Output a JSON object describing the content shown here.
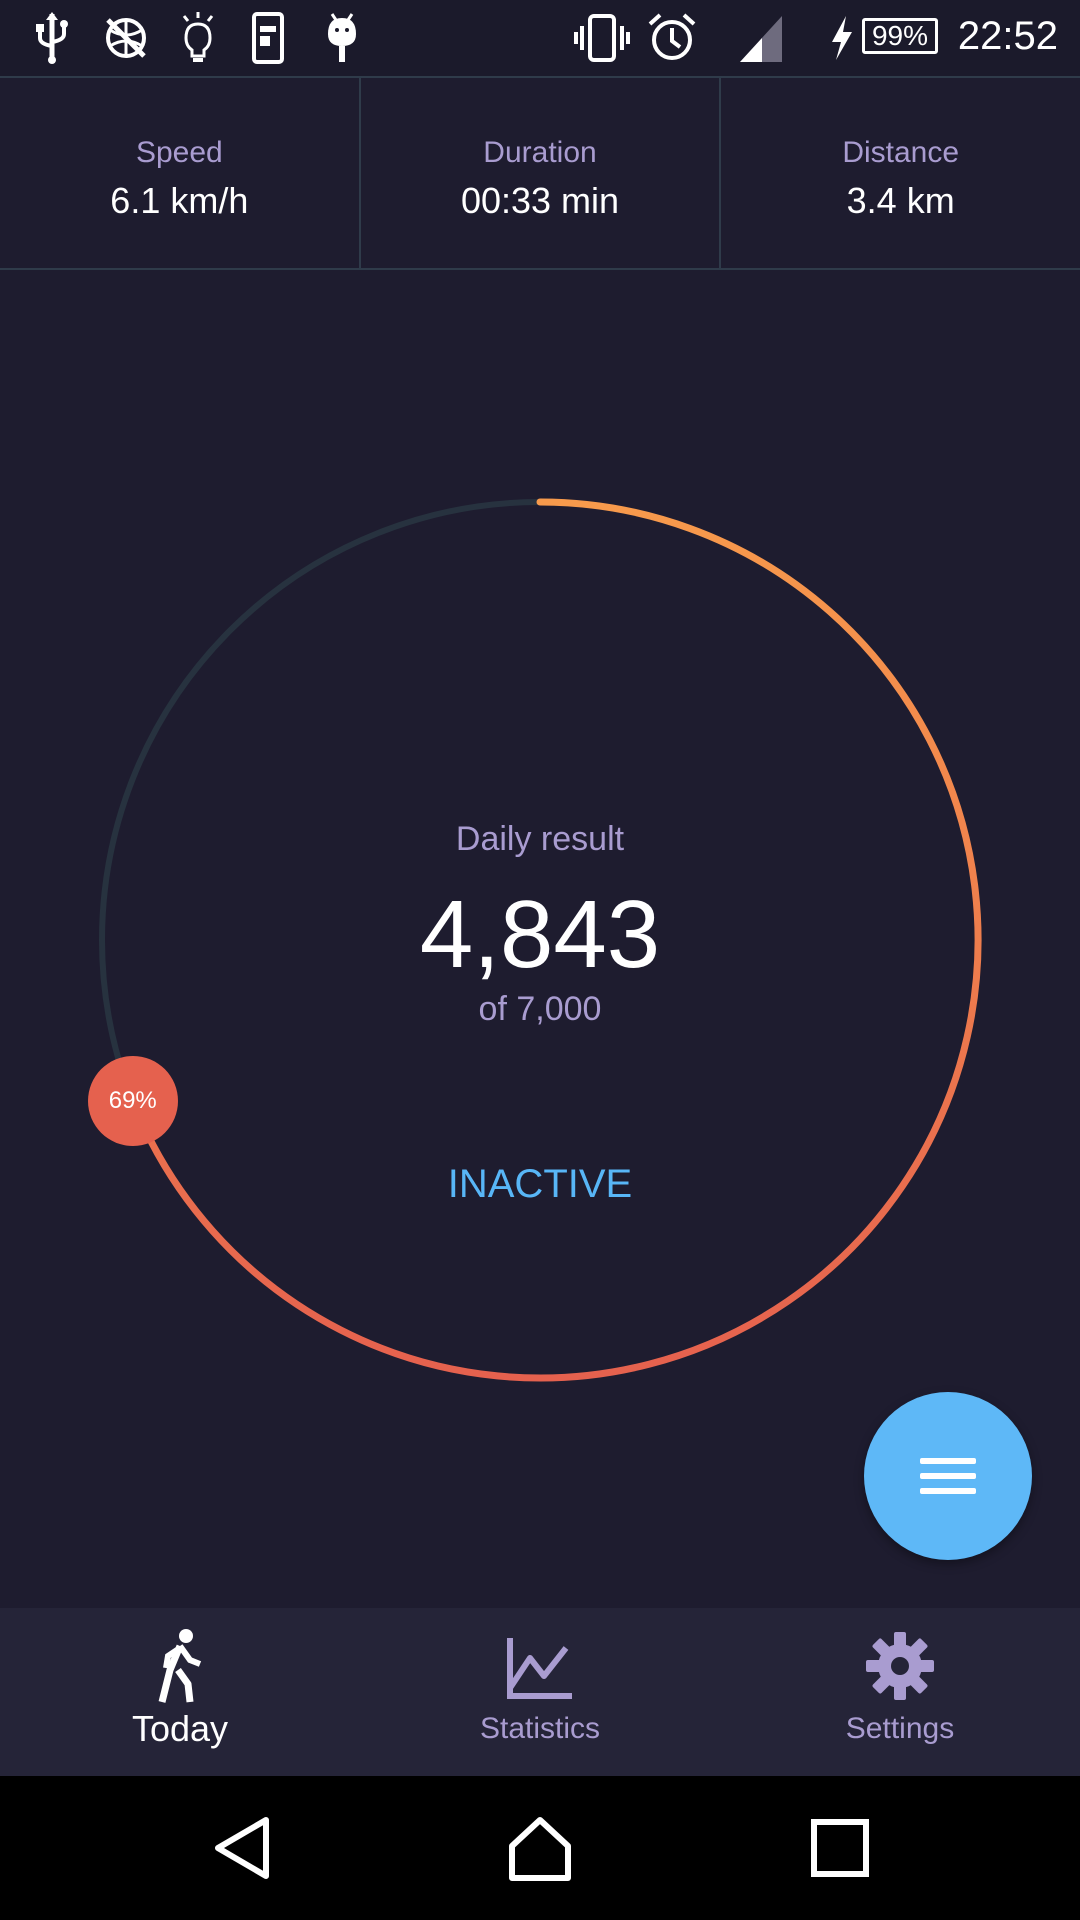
{
  "status_bar": {
    "time": "22:52",
    "battery": "99%",
    "icons_left": [
      "usb-icon",
      "no-network-icon",
      "lightbulb-icon",
      "device-icon",
      "android-icon"
    ],
    "icons_right": [
      "vibrate-icon",
      "alarm-icon",
      "signal-icon",
      "charging-icon",
      "battery-icon"
    ]
  },
  "stats": {
    "speed": {
      "label": "Speed",
      "value": "6.1 km/h"
    },
    "duration": {
      "label": "Duration",
      "value": "00:33 min"
    },
    "distance": {
      "label": "Distance",
      "value": "3.4 km"
    }
  },
  "daily": {
    "label": "Daily result",
    "steps": "4,843",
    "goal": "of 7,000",
    "percent_label": "69%",
    "progress": 0.69,
    "status_button": "INACTIVE"
  },
  "colors": {
    "background": "#1e1c2f",
    "ring_track": "#27323f",
    "ring_start": "#f79a4c",
    "ring_end": "#e5614e",
    "accent_blue": "#58b6f7",
    "label_purple": "#a99cd0"
  },
  "fab": {
    "icon": "menu-icon"
  },
  "bottom_nav": {
    "items": [
      {
        "label": "Today",
        "icon": "walking-person-icon",
        "active": true
      },
      {
        "label": "Statistics",
        "icon": "chart-icon",
        "active": false
      },
      {
        "label": "Settings",
        "icon": "gear-icon",
        "active": false
      }
    ]
  },
  "system_nav": {
    "buttons": [
      "back-icon",
      "home-icon",
      "recents-icon"
    ]
  }
}
